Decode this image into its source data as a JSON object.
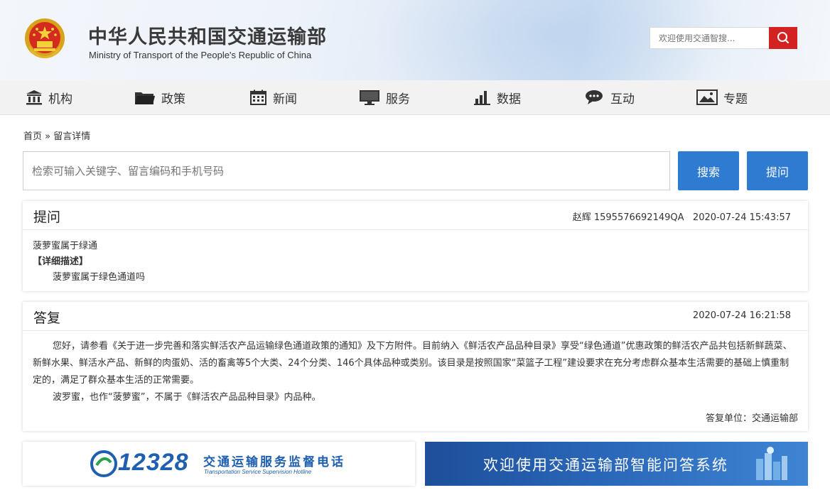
{
  "header": {
    "title_cn": "中华人民共和国交通运输部",
    "title_en": "Ministry of Transport of the People's Republic of China",
    "search_placeholder": "欢迎使用交通智搜..."
  },
  "nav": [
    {
      "label": "机构",
      "icon": "building-icon"
    },
    {
      "label": "政策",
      "icon": "folder-icon"
    },
    {
      "label": "新闻",
      "icon": "calendar-icon"
    },
    {
      "label": "服务",
      "icon": "monitor-icon"
    },
    {
      "label": "数据",
      "icon": "bar-chart-icon"
    },
    {
      "label": "互动",
      "icon": "chat-icon"
    },
    {
      "label": "专题",
      "icon": "image-icon"
    }
  ],
  "breadcrumb": {
    "home": "首页",
    "sep": "»",
    "current": "留言详情"
  },
  "qa_search": {
    "placeholder": "检索可输入关键字、留言编码和手机号码",
    "search_label": "搜索",
    "ask_label": "提问"
  },
  "question": {
    "heading": "提问",
    "author": "赵辉",
    "code": "1595576692149QA",
    "time": "2020-07-24 15:43:57",
    "subject": "菠萝蜜属于绿通",
    "detail_label": "【详细描述】",
    "detail": "菠萝蜜属于绿色通道吗"
  },
  "answer": {
    "heading": "答复",
    "time": "2020-07-24 16:21:58",
    "paragraph1": "您好，请参看《关于进一步完善和落实鲜活农产品运输绿色通道政策的通知》及下方附件。目前纳入《鲜活农产品品种目录》享受“绿色通道”优惠政策的鲜活农产品共包括新鲜蔬菜、新鲜水果、鲜活水产品、新鲜的肉蛋奶、活的畜禽等5个大类、24个分类、146个具体品种或类别。该目录是按照国家“菜篮子工程”建设要求在充分考虑群众基本生活需要的基础上慎重制定的，满足了群众基本生活的正常需要。",
    "paragraph2": "波罗蜜，也作“菠萝蜜”，不属于《鲜活农产品品种目录》内品种。",
    "unit": "答复单位：交通运输部"
  },
  "banners": {
    "hotline_number": "12328",
    "hotline_cn": "交通运输服务监督电话",
    "hotline_en": "Transportation Service Supervision Hotline",
    "qa_system": "欢迎使用交通运输部智能问答系统"
  },
  "colors": {
    "accent_red": "#d32222",
    "button_blue": "#2f7bd1",
    "hotline_blue": "#1f5fb0",
    "hotline_green": "#2aa14a"
  }
}
